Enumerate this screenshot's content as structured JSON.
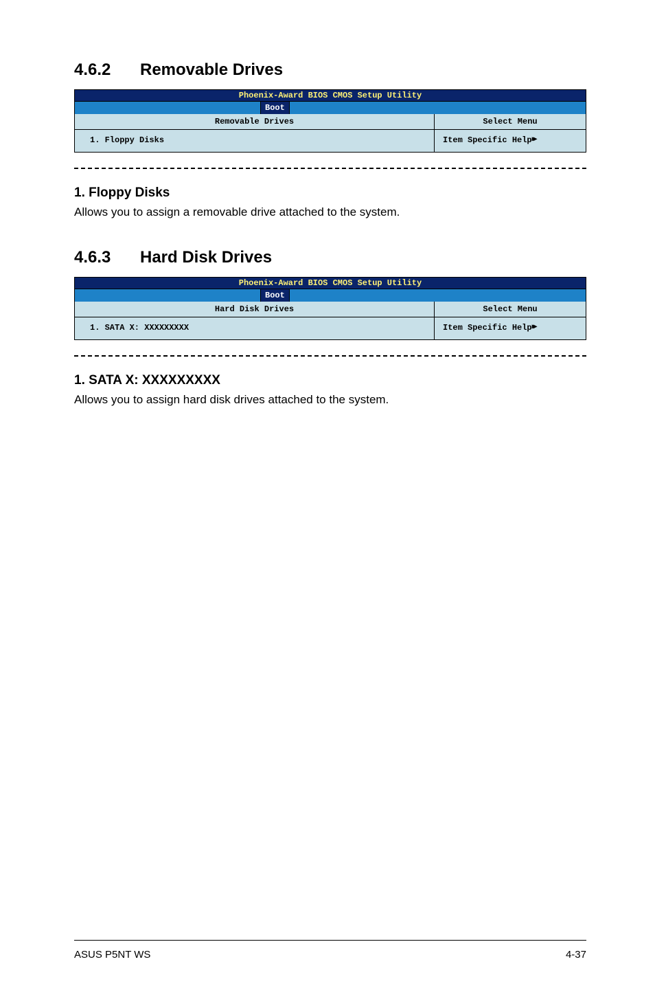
{
  "section1": {
    "number": "4.6.2",
    "title": "Removable Drives",
    "bios": {
      "utility_title": "Phoenix-Award BIOS CMOS Setup Utility",
      "tab": "Boot",
      "panel_title": "Removable Drives",
      "select_menu": "Select Menu",
      "item1": "1. Floppy Disks",
      "help_label": "Item Specific Help"
    },
    "sub_heading": "1. Floppy Disks",
    "body": "Allows you to assign a removable drive attached to the system."
  },
  "section2": {
    "number": "4.6.3",
    "title": "Hard Disk Drives",
    "bios": {
      "utility_title": "Phoenix-Award BIOS CMOS Setup Utility",
      "tab": "Boot",
      "panel_title": "Hard Disk Drives",
      "select_menu": "Select Menu",
      "item1": "1.  SATA X: XXXXXXXXX",
      "help_label": "Item Specific Help"
    },
    "sub_heading": "1. SATA X: XXXXXXXXX",
    "body": "Allows you to assign hard disk drives attached to the system."
  },
  "footer": {
    "left": "ASUS P5NT WS",
    "right": "4-37"
  }
}
